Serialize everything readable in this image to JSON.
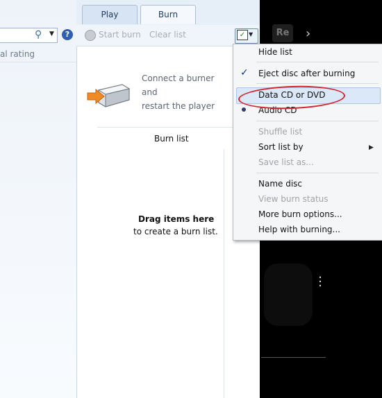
{
  "tabs": {
    "play": "Play",
    "burn": "Burn"
  },
  "left_pane": {
    "rating_header": "al rating"
  },
  "toolbar": {
    "start_burn": "Start burn",
    "clear_list": "Clear list"
  },
  "burn_pane": {
    "connect_line1": "Connect a burner and",
    "connect_line2": "restart the player",
    "burn_list_title": "Burn list",
    "drag_title": "Drag items here",
    "drag_subtitle": "to create a burn list."
  },
  "menu": {
    "hide_list": "Hide list",
    "eject_disc": "Eject disc after burning",
    "data_cd": "Data CD or DVD",
    "audio_cd": "Audio CD",
    "shuffle_list": "Shuffle list",
    "sort_list_by": "Sort list by",
    "save_list_as": "Save list as...",
    "name_disc": "Name disc",
    "view_burn_status": "View burn status",
    "more_burn_options": "More burn options...",
    "help_with_burning": "Help with burning..."
  },
  "background": {
    "dark_button_label": "Re"
  },
  "colors": {
    "highlight_ellipse": "#d6202a",
    "menu_highlight": "#dbe8f7",
    "dark_panel": "#000000"
  }
}
